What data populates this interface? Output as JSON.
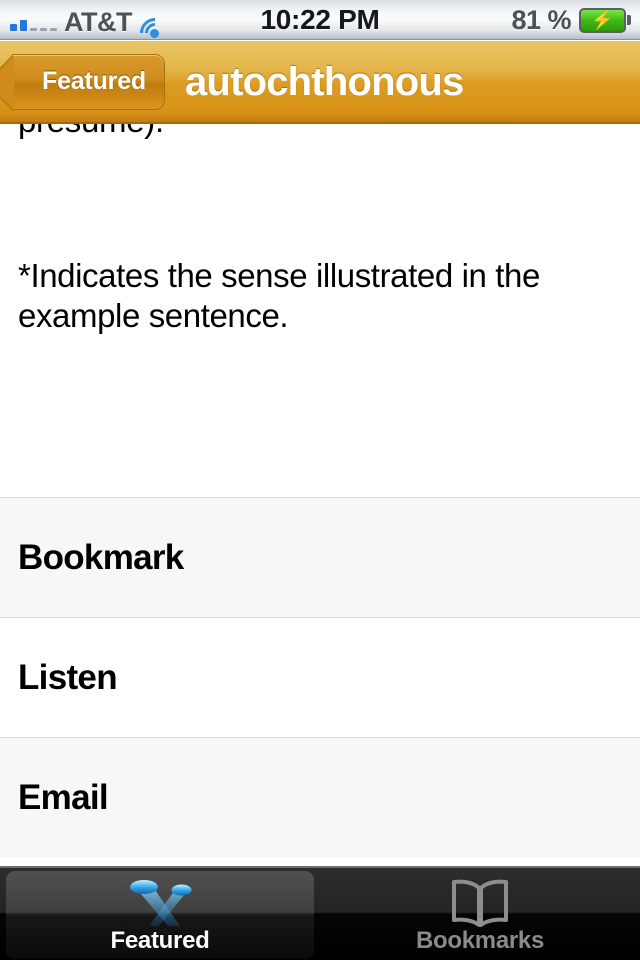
{
  "statusbar": {
    "carrier": "AT&T",
    "time": "10:22 PM",
    "battery_percent": "81 %",
    "signal_bars_filled": 2,
    "signal_bars_total": 5,
    "wifi_icon": "wifi-icon",
    "battery_icon": "battery-charging-icon",
    "battery_color": "#3fb914"
  },
  "navbar": {
    "back_label": "Featured",
    "title": "autochthonous",
    "accent_color": "#dc9d22"
  },
  "content": {
    "clipped_line": "presume).",
    "note": "*Indicates the sense illustrated in the example sentence."
  },
  "list": {
    "rows": [
      {
        "label": "Bookmark"
      },
      {
        "label": "Listen"
      },
      {
        "label": "Email"
      }
    ]
  },
  "tabbar": {
    "tabs": [
      {
        "label": "Featured",
        "icon": "spotlight-icon",
        "selected": true
      },
      {
        "label": "Bookmarks",
        "icon": "open-book-icon",
        "selected": false
      }
    ]
  }
}
